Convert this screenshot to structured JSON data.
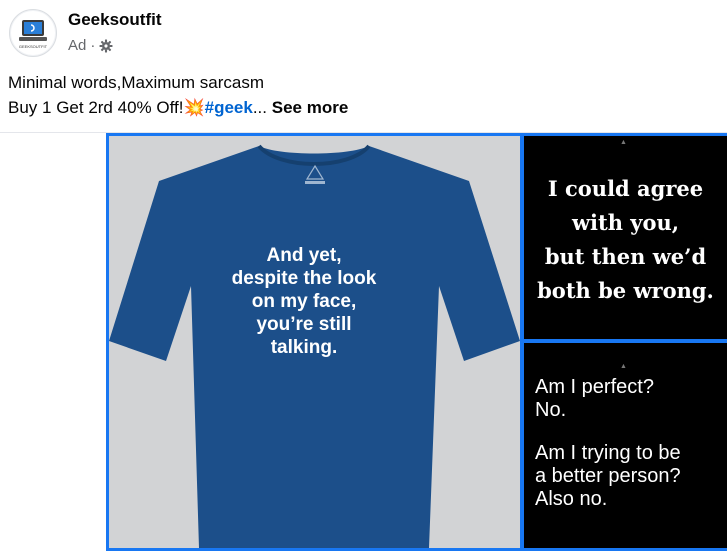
{
  "post": {
    "page_name": "Geeksoutfit",
    "ad_label": "Ad",
    "dot": "·",
    "avatar_text": "GEEKSOUTFIT",
    "caption_line1": "Minimal words,Maximum sarcasm",
    "caption_line2_text": "Buy 1 Get 2rd 40% Off!",
    "caption_emoji": "💥",
    "hashtag": "#geek",
    "ellipsis": "...",
    "see_more": "See more"
  },
  "images": {
    "shirt_text": [
      "And yet,",
      "despite the look",
      "on my face,",
      "you’re still",
      "talking."
    ],
    "quote_top": [
      "I could agree",
      "with you,",
      "but then we’d",
      "both be wrong."
    ],
    "quote_bottom_a": [
      "Am I perfect?",
      "No."
    ],
    "quote_bottom_b": [
      "Am I trying to be",
      "a better person?",
      "Also no."
    ]
  },
  "colors": {
    "shirt": "#1c4f8a",
    "collage_border": "#1877f2",
    "hashtag": "#0064d1"
  }
}
